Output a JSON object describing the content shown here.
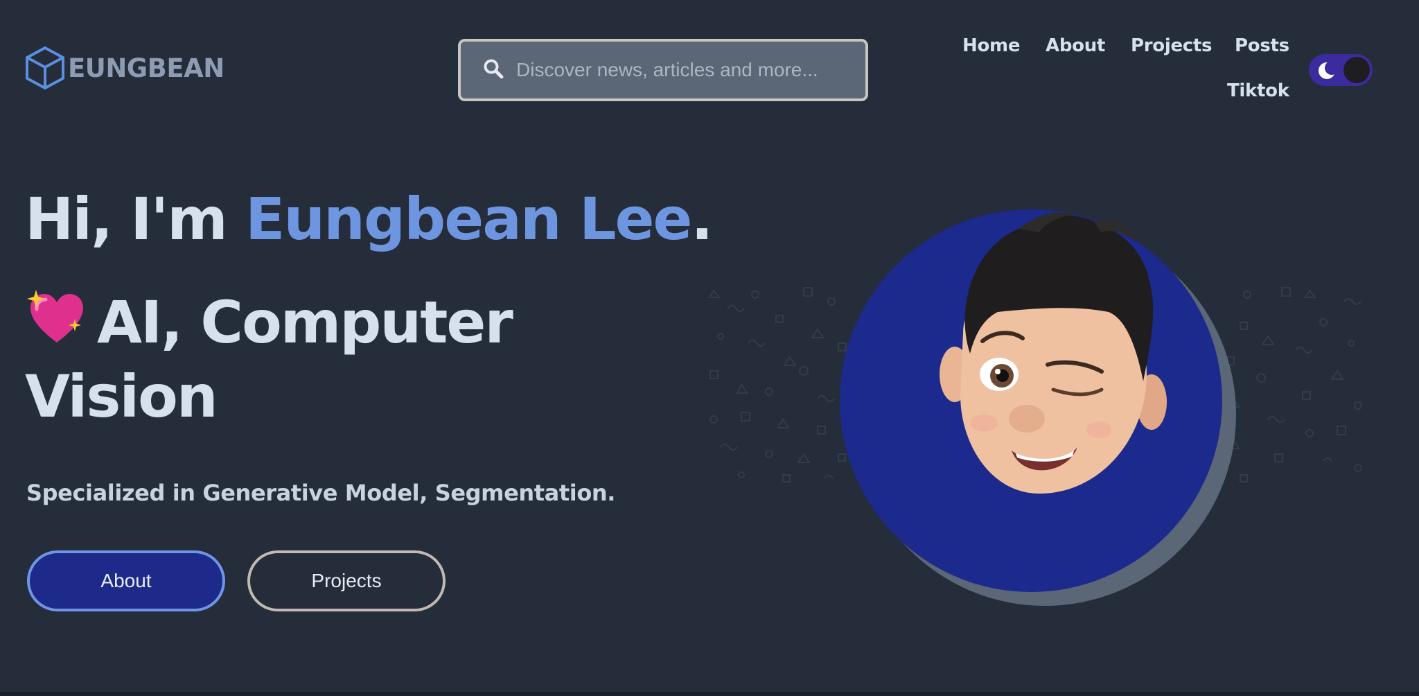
{
  "header": {
    "logo_text": "EUNGBEAN",
    "logo_icon": "cube-icon",
    "search": {
      "placeholder": "Discover news, articles and more...",
      "value": "",
      "icon": "search-icon"
    },
    "nav": [
      {
        "label": "Home"
      },
      {
        "label": "About"
      },
      {
        "label": "Projects"
      },
      {
        "label": "Posts"
      },
      {
        "label": "Tiktok"
      }
    ],
    "theme_toggle": {
      "mode": "dark",
      "icon": "moon-icon"
    }
  },
  "hero": {
    "greeting_prefix": "Hi, I'm ",
    "name": "Eungbean Lee",
    "greeting_suffix": ".",
    "emoji": "💖",
    "tagline_line1": "AI, Computer",
    "tagline_line2": "Vision",
    "subtitle": "Specialized in Generative Model, Segmentation.",
    "buttons": {
      "about": "About",
      "projects": "Projects"
    }
  },
  "avatar": {
    "icon": "winking-memoji-avatar"
  },
  "colors": {
    "background": "#252c3a",
    "accent": "#6e95e0",
    "primary_button": "#1d2a8a",
    "avatar_circle": "#1b2a8c",
    "toggle": "#3b2b9e"
  }
}
